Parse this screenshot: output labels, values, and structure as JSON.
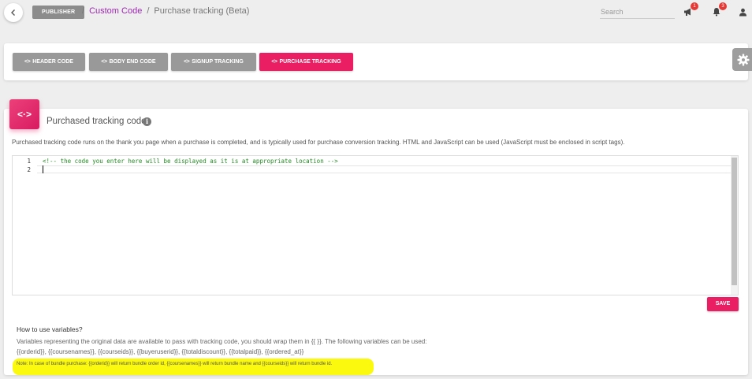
{
  "topbar": {
    "publisher_label": "PUBLISHER",
    "breadcrumb": {
      "link": "Custom Code",
      "separator": "/",
      "current": "Purchase tracking (Beta)"
    },
    "search": {
      "placeholder": "Search"
    },
    "icons": {
      "back": "chevron-left-icon",
      "megaphone": "megaphone-icon",
      "bell": "bell-icon",
      "user": "user-icon"
    },
    "megaphone_badge": "1",
    "bell_badge": "3"
  },
  "tabs": [
    {
      "glyph": "<>",
      "label": "HEADER CODE",
      "active": false
    },
    {
      "glyph": "<>",
      "label": "BODY END CODE",
      "active": false
    },
    {
      "glyph": "<>",
      "label": "SIGNUP TRACKING",
      "active": false
    },
    {
      "glyph": "<>",
      "label": "PURCHASE TRACKING",
      "active": true
    }
  ],
  "settings_icon": "gear-icon",
  "card": {
    "icon_glyph": "<·>",
    "title": "Purchased tracking code",
    "info_icon": "i",
    "description": "Purchased tracking code runs on the thank you page when a purchase is completed, and is typically used for purchase conversion tracking. HTML and JavaScript can be used (JavaScript must be enclosed in script tags)."
  },
  "editor": {
    "lines": [
      {
        "number": "1",
        "text": "<!-- the code you enter here will be displayed as it is at appropriate location -->"
      },
      {
        "number": "2",
        "text": ""
      }
    ]
  },
  "save_label": "SAVE",
  "help": {
    "title": "How to use variables?",
    "line1": "Variables representing the original data are available to pass with tracking code, you should wrap them in {{ }}. The following variables can be used:",
    "line2": "{{orderid}}, {{coursenames}}, {{courseids}}, {{buyeruserid}}, {{totaldiscount}}, {{totalpaid}}, {{ordered_at}}",
    "note": "Note: In case of bundle purchase: {{orderid}} will return bundle order id, {{coursenames}} will return bundle name and {{courseids}} will return bundle id."
  },
  "colors": {
    "accent": "#e91e63",
    "tab_inactive": "#999999",
    "link": "#9c27b0",
    "highlight": "#fbf90d"
  }
}
